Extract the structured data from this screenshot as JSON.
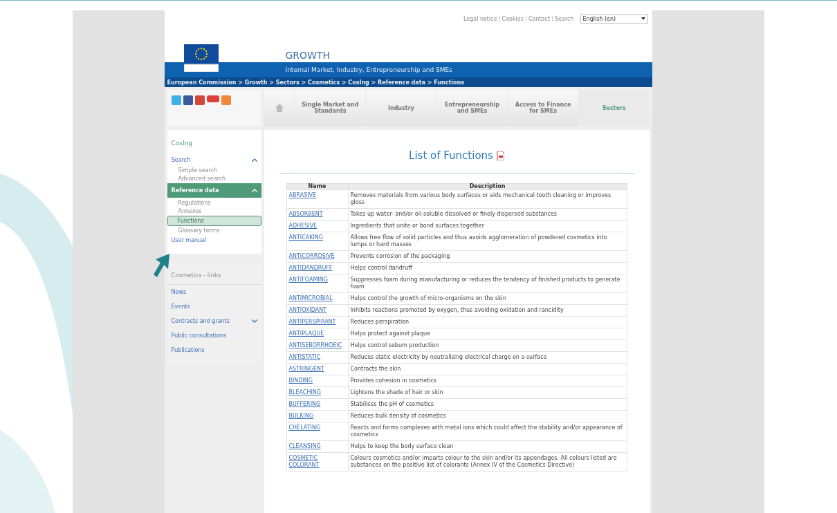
{
  "top_links": [
    "Legal notice",
    "Cookies",
    "Contact",
    "Search"
  ],
  "language_select": {
    "value": "English (en)"
  },
  "site": {
    "title": "GROWTH",
    "subtitle": "Internal Market, Industry, Entrepreneurship and SMEs"
  },
  "breadcrumb": "European Commission > Growth > Sectors > Cosmetics > CosIng > Reference data > Functions",
  "nav": [
    {
      "label": "Single Market and Standards",
      "selected": false
    },
    {
      "label": "Industry",
      "selected": false
    },
    {
      "label": "Entrepreneurship and SMEs",
      "selected": false
    },
    {
      "label": "Access to Finance for SMEs",
      "selected": false
    },
    {
      "label": "Sectors",
      "selected": true
    }
  ],
  "sidebar": {
    "title": "CosIng",
    "items": [
      {
        "kind": "group",
        "label": "Search",
        "expanded": true,
        "selected": false,
        "children": [
          {
            "label": "Simple search",
            "selected": false
          },
          {
            "label": "Advanced search",
            "selected": false
          }
        ]
      },
      {
        "kind": "group",
        "label": "Reference data",
        "expanded": true,
        "selected": true,
        "children": [
          {
            "label": "Regulations",
            "selected": false
          },
          {
            "label": "Annexes",
            "selected": false
          },
          {
            "label": "Functions",
            "selected": true
          },
          {
            "label": "Glossary terms",
            "selected": false
          }
        ]
      },
      {
        "kind": "link",
        "label": "User manual",
        "selected": false
      }
    ]
  },
  "links_box": {
    "title": "Cosmetics - links",
    "items": [
      {
        "kind": "link",
        "label": "News"
      },
      {
        "kind": "link",
        "label": "Events"
      },
      {
        "kind": "group",
        "label": "Contracts and grants",
        "expanded": false
      },
      {
        "kind": "link",
        "label": "Public consultations"
      },
      {
        "kind": "link",
        "label": "Publications"
      }
    ]
  },
  "page_title": "List of Functions",
  "table": {
    "columns": [
      "Name",
      "Description"
    ],
    "rows": [
      {
        "name": "ABRASIVE",
        "description": "Removes materials from various body surfaces or aids mechanical tooth cleaning or improves gloss"
      },
      {
        "name": "ABSORBENT",
        "description": "Takes up water- and/or oil-soluble dissolved or finely dispersed substances"
      },
      {
        "name": "ADHESIVE",
        "description": "Ingredients that unite or bond surfaces together"
      },
      {
        "name": "ANTICAKING",
        "description": "Allows free flow of solid particles and thus avoids agglomeration of powdered cosmetics into lumps or hard masses"
      },
      {
        "name": "ANTICORROSIVE",
        "description": "Prevents corrosion of the packaging"
      },
      {
        "name": "ANTIDANDRUFF",
        "description": "Helps control dandruff"
      },
      {
        "name": "ANTIFOAMING",
        "description": "Suppresses foam during manufacturing or reduces the tendency of finished products to generate foam"
      },
      {
        "name": "ANTIMICROBIAL",
        "description": "Helps control the growth of micro-organisms on the skin"
      },
      {
        "name": "ANTIOXIDANT",
        "description": "Inhibits reactions promoted by oxygen, thus avoiding oxidation and rancidity"
      },
      {
        "name": "ANTIPERSPIRANT",
        "description": "Reduces perspiration"
      },
      {
        "name": "ANTIPLAQUE",
        "description": "Helps protect against plaque"
      },
      {
        "name": "ANTISEBORRHOEIC",
        "description": "Helps control sebum production"
      },
      {
        "name": "ANTISTATIC",
        "description": "Reduces static electricity by neutralising electrical charge on a surface"
      },
      {
        "name": "ASTRINGENT",
        "description": "Contracts the skin"
      },
      {
        "name": "BINDING",
        "description": "Provides cohesion in cosmetics"
      },
      {
        "name": "BLEACHING",
        "description": "Lightens the shade of hair or skin"
      },
      {
        "name": "BUFFERING",
        "description": "Stabilises the pH of cosmetics"
      },
      {
        "name": "BULKING",
        "description": "Reduces bulk density of cosmetics"
      },
      {
        "name": "CHELATING",
        "description": "Reacts and forms complexes with metal ions which could affect the stability and/or appearance of cosmetics"
      },
      {
        "name": "CLEANSING",
        "description": "Helps to keep the body surface clean"
      },
      {
        "name": "COSMETIC COLORANT",
        "description": "Colours cosmetics and/or imparts colour to the skin and/or its appendages. All colours listed are substances on the positive list of colorants (Annex IV of the Cosmetics Directive)"
      }
    ]
  }
}
